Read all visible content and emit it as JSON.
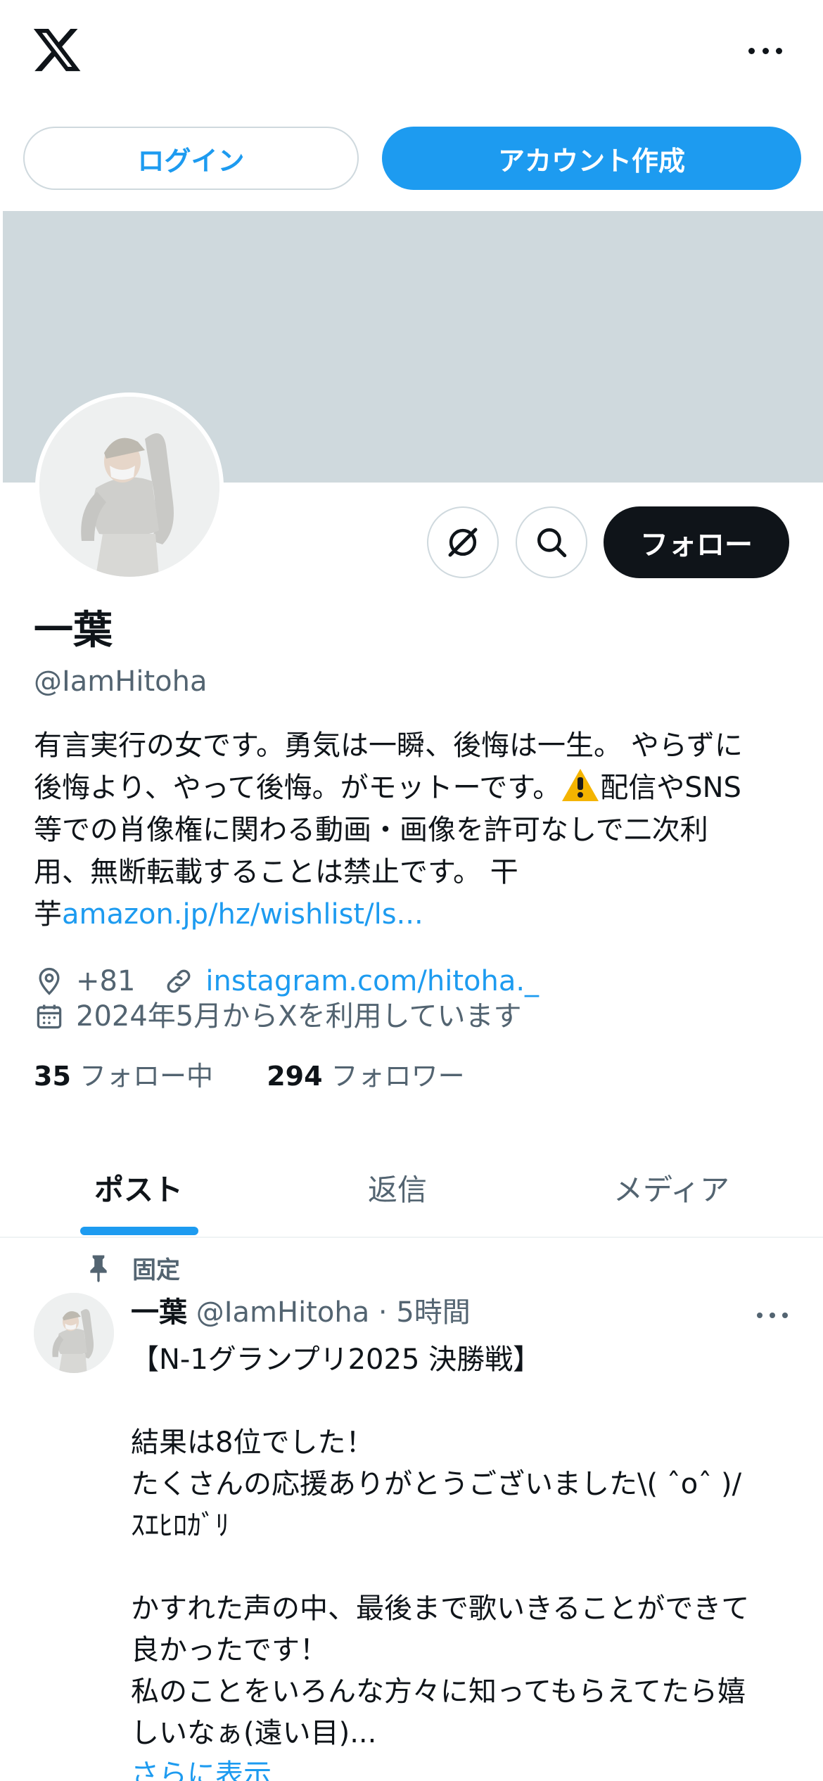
{
  "topbar": {
    "logo_icon": "x-logo-icon",
    "more_icon": "more-horizontal-icon"
  },
  "auth": {
    "login_label": "ログイン",
    "signup_label": "アカウント作成"
  },
  "colors": {
    "accent": "#1d9bf0",
    "banner": "#cfd9dd",
    "dark": "#0f1419",
    "muted": "#536471"
  },
  "profile": {
    "actions": {
      "grok_icon": "grok-icon",
      "search_icon": "search-icon",
      "follow_label": "フォロー"
    },
    "display_name": "一葉",
    "handle": "@IamHitoha",
    "bio": {
      "line1": "有言実行の女です。勇気は一瞬、後悔は一生。 やらずに",
      "line2_a": "後悔より、やって後悔。がモットーです。",
      "line2_b": "配信やSNS",
      "line3": "等での肖像権に関わる動画・画像を許可なしで二次利",
      "line4": "用、無断転載することは禁止です。 干",
      "line5_a": "芋",
      "line5_link": "amazon.jp/hz/wishlist/ls..."
    },
    "location": "+81",
    "website": "instagram.com/hitoha._",
    "joined": "2024年5月からXを利用しています",
    "following_count": "35",
    "following_label": "フォロー中",
    "followers_count": "294",
    "followers_label": "フォロワー"
  },
  "tabs": [
    {
      "label": "ポスト",
      "active": true
    },
    {
      "label": "返信",
      "active": false
    },
    {
      "label": "メディア",
      "active": false
    }
  ],
  "pinned_post": {
    "pinned_label": "固定",
    "author_name": "一葉",
    "author_handle": "@IamHitoha",
    "separator": "·",
    "time": "5時間",
    "lines": [
      "【N-1グランプリ2025 決勝戦】",
      "",
      "結果は8位でした！",
      "たくさんの応援ありがとうございました\\( ˆoˆ )/",
      "ｽｴﾋﾛｶﾞﾘ",
      "",
      "かすれた声の中、最後まで歌いきることができて",
      "良かったです！",
      "私のことをいろんな方々に知ってもらえてたら嬉",
      "しいなぁ(遠い目)..."
    ],
    "show_more": "さらに表示"
  }
}
